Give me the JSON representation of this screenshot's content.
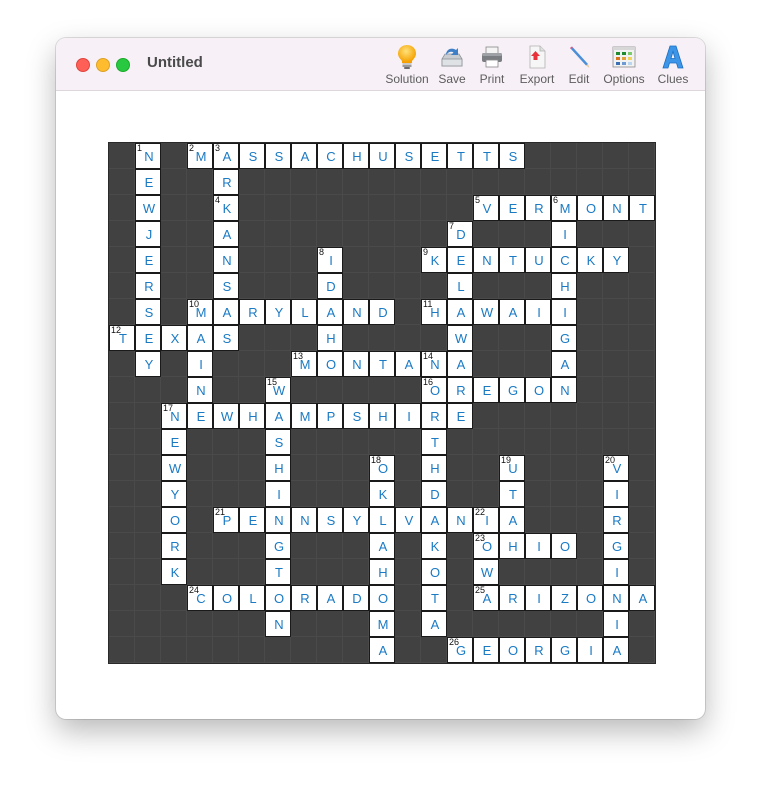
{
  "window": {
    "title": "Untitled"
  },
  "toolbar": {
    "items": [
      {
        "id": "solution",
        "label": "Solution",
        "icon": "lightbulb-icon"
      },
      {
        "id": "save",
        "label": "Save",
        "icon": "save-drive-icon"
      },
      {
        "id": "print",
        "label": "Print",
        "icon": "printer-icon"
      },
      {
        "id": "export",
        "label": "Export",
        "icon": "export-document-icon"
      },
      {
        "id": "edit",
        "label": "Edit",
        "icon": "pencil-icon"
      },
      {
        "id": "options",
        "label": "Options",
        "icon": "color-grid-icon"
      },
      {
        "id": "clues",
        "label": "Clues",
        "icon": "letter-a-icon"
      }
    ]
  },
  "puzzle": {
    "rows": 20,
    "cols": 21,
    "letter_color": "#1a7ac4",
    "block_color": "#414141",
    "entries": [
      {
        "number": 1,
        "direction": "down",
        "row": 0,
        "col": 1,
        "answer": "NEWJERSEY"
      },
      {
        "number": 2,
        "direction": "across",
        "row": 0,
        "col": 3,
        "answer": "MASSACHUSETTS"
      },
      {
        "number": 3,
        "direction": "down",
        "row": 0,
        "col": 4,
        "answer": "ARKANSAS"
      },
      {
        "number": 4,
        "direction": "down",
        "row": 2,
        "col": 4,
        "answer": "KANSAS"
      },
      {
        "number": 5,
        "direction": "across",
        "row": 2,
        "col": 14,
        "answer": "VERMONT"
      },
      {
        "number": 6,
        "direction": "down",
        "row": 2,
        "col": 17,
        "answer": "MICHIGAN"
      },
      {
        "number": 7,
        "direction": "down",
        "row": 3,
        "col": 13,
        "answer": "DELAWARE"
      },
      {
        "number": 8,
        "direction": "down",
        "row": 4,
        "col": 8,
        "answer": "IDAHO"
      },
      {
        "number": 9,
        "direction": "across",
        "row": 4,
        "col": 12,
        "answer": "KENTUCKY"
      },
      {
        "number": 10,
        "direction": "across",
        "row": 6,
        "col": 3,
        "answer": "MARYLAND"
      },
      {
        "number": 10,
        "direction": "down",
        "row": 6,
        "col": 3,
        "answer": "MAINE"
      },
      {
        "number": 11,
        "direction": "across",
        "row": 6,
        "col": 12,
        "answer": "HAWAII"
      },
      {
        "number": 12,
        "direction": "across",
        "row": 7,
        "col": 0,
        "answer": "TEXAS"
      },
      {
        "number": 13,
        "direction": "across",
        "row": 8,
        "col": 7,
        "answer": "MONTANA"
      },
      {
        "number": 14,
        "direction": "down",
        "row": 8,
        "col": 12,
        "answer": "NORTHDAKOTA"
      },
      {
        "number": 15,
        "direction": "down",
        "row": 9,
        "col": 6,
        "answer": "WASHINGTON"
      },
      {
        "number": 16,
        "direction": "across",
        "row": 9,
        "col": 12,
        "answer": "OREGON"
      },
      {
        "number": 17,
        "direction": "across",
        "row": 10,
        "col": 2,
        "answer": "NEWHAMPSHIRE"
      },
      {
        "number": 17,
        "direction": "down",
        "row": 10,
        "col": 2,
        "answer": "NEWYORK"
      },
      {
        "number": 18,
        "direction": "down",
        "row": 12,
        "col": 10,
        "answer": "OKLAHOMA"
      },
      {
        "number": 19,
        "direction": "down",
        "row": 12,
        "col": 15,
        "answer": "UTAH"
      },
      {
        "number": 20,
        "direction": "down",
        "row": 12,
        "col": 19,
        "answer": "VIRGINIA"
      },
      {
        "number": 21,
        "direction": "across",
        "row": 14,
        "col": 4,
        "answer": "PENNSYLVANIA"
      },
      {
        "number": 22,
        "direction": "down",
        "row": 14,
        "col": 14,
        "answer": "IOWA"
      },
      {
        "number": 23,
        "direction": "across",
        "row": 15,
        "col": 14,
        "answer": "OHIO"
      },
      {
        "number": 24,
        "direction": "across",
        "row": 17,
        "col": 3,
        "answer": "COLORADO"
      },
      {
        "number": 25,
        "direction": "across",
        "row": 17,
        "col": 14,
        "answer": "ARIZONA"
      },
      {
        "number": 26,
        "direction": "across",
        "row": 19,
        "col": 13,
        "answer": "GEORGIA"
      }
    ]
  }
}
